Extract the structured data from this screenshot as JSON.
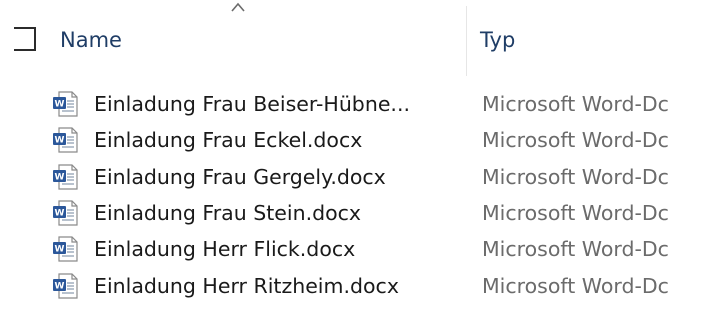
{
  "header": {
    "name_label": "Name",
    "type_label": "Typ"
  },
  "icons": {
    "header_checkbox": "checkbox-icon",
    "sort": "sort-ascending-icon",
    "file": "word-document-icon"
  },
  "colors": {
    "header_text": "#1f3d66",
    "type_text": "#6b6b6b",
    "word_blue": "#2b579a"
  },
  "files": [
    {
      "name": "Einladung Frau Beiser-Hübne...",
      "type": "Microsoft Word-Dc"
    },
    {
      "name": "Einladung Frau Eckel.docx",
      "type": "Microsoft Word-Dc"
    },
    {
      "name": "Einladung Frau Gergely.docx",
      "type": "Microsoft Word-Dc"
    },
    {
      "name": "Einladung Frau Stein.docx",
      "type": "Microsoft Word-Dc"
    },
    {
      "name": "Einladung Herr Flick.docx",
      "type": "Microsoft Word-Dc"
    },
    {
      "name": "Einladung Herr Ritzheim.docx",
      "type": "Microsoft Word-Dc"
    }
  ]
}
